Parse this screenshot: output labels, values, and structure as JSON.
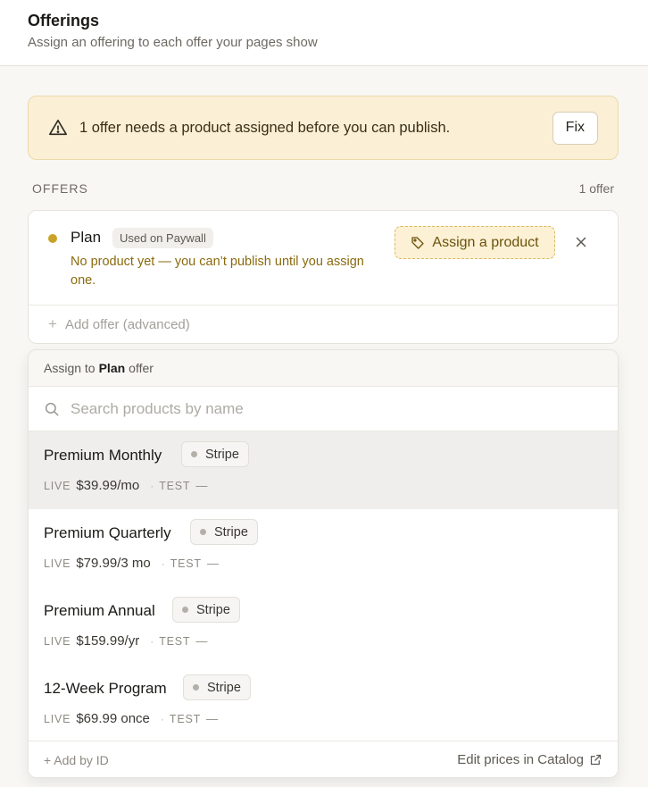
{
  "header": {
    "title": "Offerings",
    "subtitle": "Assign an offering to each offer your pages show"
  },
  "banner": {
    "message": "1 offer needs a product assigned before you can publish.",
    "fix_label": "Fix",
    "icon": "warning-triangle-icon"
  },
  "offers_section": {
    "label": "OFFERS",
    "count": "1 offer"
  },
  "offer": {
    "name": "Plan",
    "badge": "Used on Paywall",
    "warning": "No product yet — you can’t publish until you assign one.",
    "assign_label": "Assign a product",
    "status_color": "#c9a227"
  },
  "add_offer_label": "Add offer (advanced)",
  "dropdown": {
    "prefix": "Assign to",
    "offer_name": "Plan",
    "suffix": "offer",
    "search_placeholder": "Search products by name",
    "products": [
      {
        "name": "Premium Monthly",
        "provider": "Stripe",
        "live_label": "LIVE",
        "live_price": "$39.99/mo",
        "test_label": "TEST",
        "test_price": "—"
      },
      {
        "name": "Premium Quarterly",
        "provider": "Stripe",
        "live_label": "LIVE",
        "live_price": "$79.99/3 mo",
        "test_label": "TEST",
        "test_price": "—"
      },
      {
        "name": "Premium Annual",
        "provider": "Stripe",
        "live_label": "LIVE",
        "live_price": "$159.99/yr",
        "test_label": "TEST",
        "test_price": "—"
      },
      {
        "name": "12-Week Program",
        "provider": "Stripe",
        "live_label": "LIVE",
        "live_price": "$69.99 once",
        "test_label": "TEST",
        "test_price": "—"
      }
    ],
    "footer": {
      "add_by_id": "+ Add by ID",
      "edit_catalog": "Edit prices in Catalog"
    }
  }
}
